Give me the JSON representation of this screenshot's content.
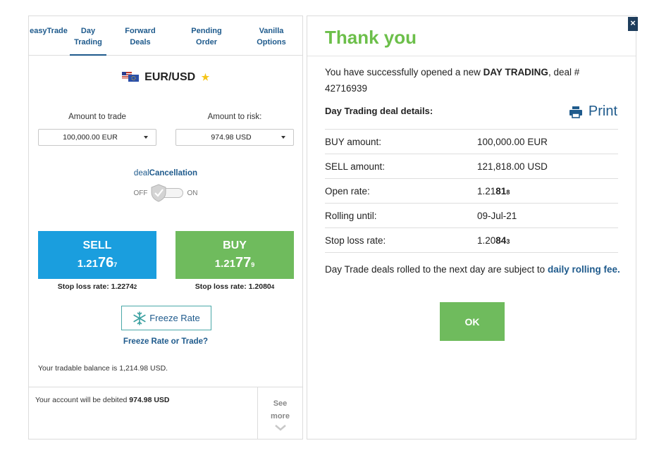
{
  "tabs": [
    {
      "label": "easyTrade"
    },
    {
      "label": "Day Trading"
    },
    {
      "label": "Forward Deals"
    },
    {
      "label": "Pending Order"
    },
    {
      "label": "Vanilla Options"
    }
  ],
  "active_tab": "Day Trading",
  "pair": {
    "label": "EUR/USD",
    "flag_icon": "us-eu-flag-icon",
    "favorite_icon": "star-icon"
  },
  "amount_to_trade": {
    "label": "Amount to trade",
    "value": "100,000.00 EUR"
  },
  "amount_to_risk": {
    "label": "Amount to risk:",
    "value": "974.98 USD"
  },
  "deal_cancellation": {
    "prefix": "deal",
    "suffix": "Cancellation",
    "off_label": "OFF",
    "on_label": "ON",
    "state": "off"
  },
  "sell": {
    "label": "SELL",
    "rate_main": "1.21",
    "rate_big": "76",
    "rate_small": "7",
    "stop_loss_label": "Stop loss rate:",
    "stop_loss_main": "1.2274",
    "stop_loss_small": "2"
  },
  "buy": {
    "label": "BUY",
    "rate_main": "1.21",
    "rate_big": "77",
    "rate_small": "9",
    "stop_loss_label": "Stop loss rate:",
    "stop_loss_main": "1.2080",
    "stop_loss_small": "4"
  },
  "freeze": {
    "button_label": "Freeze Rate",
    "link_label": "Freeze Rate or Trade?"
  },
  "balance_text": "Your tradable balance is 1,214.98 USD.",
  "debit": {
    "prefix": "Your account will be debited",
    "amount": "974.98 USD"
  },
  "see_more": {
    "line1": "See",
    "line2": "more"
  },
  "thank_you": {
    "title": "Thank you",
    "message_prefix": "You have successfully opened a new",
    "message_bold": "DAY TRADING",
    "message_mid": ", deal #",
    "deal_number": "42716939",
    "details_heading": "Day Trading deal details:",
    "print_label": "Print",
    "rows": [
      {
        "label": "BUY amount:",
        "value": "100,000.00 EUR"
      },
      {
        "label": "SELL amount:",
        "value": "121,818.00 USD"
      },
      {
        "label": "Open rate:",
        "value_main": "1.21",
        "value_bold": "81",
        "value_small": "8"
      },
      {
        "label": "Rolling until:",
        "value": "09-Jul-21"
      },
      {
        "label": "Stop loss rate:",
        "value_main": "1.20",
        "value_bold": "84",
        "value_small": "3"
      }
    ],
    "note_prefix": "Day Trade deals rolled to the next day are subject to",
    "note_link": "daily rolling fee",
    "note_suffix": ".",
    "ok_label": "OK",
    "close_label": "×"
  },
  "colors": {
    "brand_blue": "#1e5a8c",
    "sell_blue": "#1a9ede",
    "buy_green": "#6fbb5d",
    "title_green": "#6cbf4a"
  }
}
